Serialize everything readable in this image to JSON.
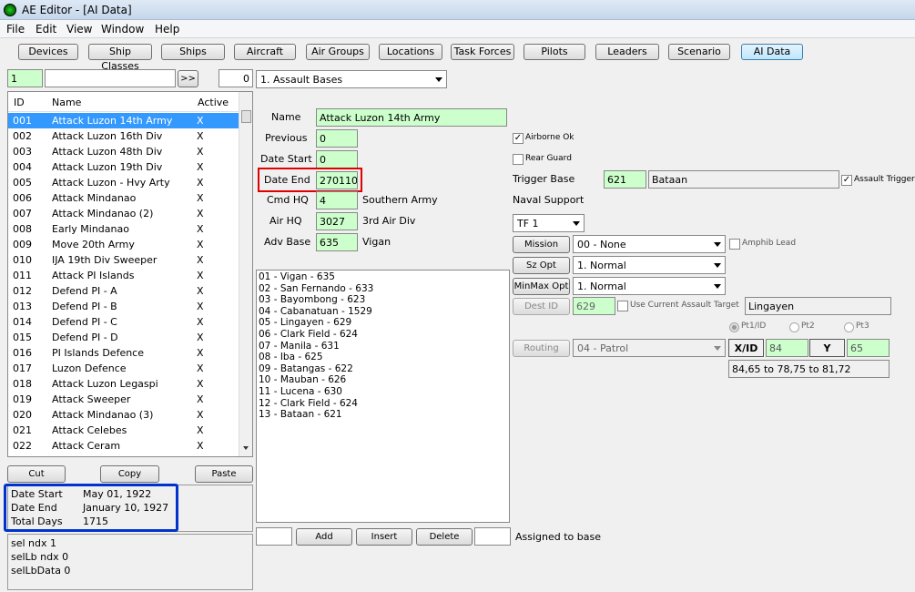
{
  "window": {
    "title": "AE Editor - [AI Data]"
  },
  "menu": [
    "File",
    "Edit",
    "View",
    "Window",
    "Help"
  ],
  "tabs": [
    "Devices",
    "Ship Classes",
    "Ships",
    "Aircraft",
    "Air Groups",
    "Locations",
    "Task Forces",
    "Pilots",
    "Leaders",
    "Scenario",
    "AI Data"
  ],
  "active_tab": "AI Data",
  "left": {
    "index_value": "1",
    "search_value": "",
    "go_label": ">>",
    "count_value": "0",
    "columns": [
      "ID",
      "Name",
      "Active"
    ],
    "rows": [
      {
        "id": "001",
        "name": "Attack Luzon 14th Army",
        "active": "X"
      },
      {
        "id": "002",
        "name": "Attack Luzon 16th Div",
        "active": "X"
      },
      {
        "id": "003",
        "name": "Attack Luzon 48th Div",
        "active": "X"
      },
      {
        "id": "004",
        "name": "Attack Luzon 19th Div",
        "active": "X"
      },
      {
        "id": "005",
        "name": "Attack Luzon - Hvy Arty",
        "active": "X"
      },
      {
        "id": "006",
        "name": "Attack Mindanao",
        "active": "X"
      },
      {
        "id": "007",
        "name": "Attack Mindanao (2)",
        "active": "X"
      },
      {
        "id": "008",
        "name": "Early Mindanao",
        "active": "X"
      },
      {
        "id": "009",
        "name": "Move 20th Army",
        "active": "X"
      },
      {
        "id": "010",
        "name": "IJA 19th Div Sweeper",
        "active": "X"
      },
      {
        "id": "011",
        "name": "Attack PI Islands",
        "active": "X"
      },
      {
        "id": "012",
        "name": "Defend PI - A",
        "active": "X"
      },
      {
        "id": "013",
        "name": "Defend PI - B",
        "active": "X"
      },
      {
        "id": "014",
        "name": "Defend PI - C",
        "active": "X"
      },
      {
        "id": "015",
        "name": "Defend PI - D",
        "active": "X"
      },
      {
        "id": "016",
        "name": "PI Islands Defence",
        "active": "X"
      },
      {
        "id": "017",
        "name": "Luzon Defence",
        "active": "X"
      },
      {
        "id": "018",
        "name": "Attack Luzon Legaspi",
        "active": "X"
      },
      {
        "id": "019",
        "name": "Attack Sweeper",
        "active": "X"
      },
      {
        "id": "020",
        "name": "Attack Mindanao (3)",
        "active": "X"
      },
      {
        "id": "021",
        "name": "Attack Celebes",
        "active": "X"
      },
      {
        "id": "022",
        "name": "Attack Ceram",
        "active": "X"
      }
    ],
    "cut_label": "Cut",
    "copy_label": "Copy",
    "paste_label": "Paste",
    "info": {
      "date_start_label": "Date Start",
      "date_start": "May 01, 1922",
      "date_end_label": "Date End",
      "date_end": "January 10, 1927",
      "total_days_label": "Total Days",
      "total_days": "1715"
    },
    "debug": [
      "sel ndx 1",
      "selLb ndx 0",
      "selLbData 0"
    ]
  },
  "mid": {
    "type_select": "1. Assault Bases",
    "name_label": "Name",
    "name_value": "Attack Luzon 14th Army",
    "previous_label": "Previous",
    "previous_value": "0",
    "date_start_label": "Date Start",
    "date_start_value": "0",
    "date_end_label": "Date End",
    "date_end_value": "270110",
    "cmd_hq_label": "Cmd HQ",
    "cmd_hq_value": "4",
    "cmd_hq_name": "Southern Army",
    "air_hq_label": "Air HQ",
    "air_hq_value": "3027",
    "air_hq_name": "3rd Air Div",
    "adv_base_label": "Adv Base",
    "adv_base_value": "635",
    "adv_base_name": "Vigan",
    "bases": [
      "01 - Vigan - 635",
      "02 - San Fernando - 633",
      "03 - Bayombong - 623",
      "04 - Cabanatuan - 1529",
      "05 - Lingayen - 629",
      "06 - Clark Field - 624",
      "07 - Manila - 631",
      "08 - Iba - 625",
      "09 - Batangas - 622",
      "10 - Mauban - 626",
      "11 - Lucena - 630",
      "12 - Clark Field - 624",
      "13 - Bataan - 621"
    ],
    "add_label": "Add",
    "insert_label": "Insert",
    "delete_label": "Delete",
    "assigned_label": "Assigned to base"
  },
  "right": {
    "airborne_label": "Airborne Ok",
    "airborne_checked": true,
    "rear_guard_label": "Rear Guard",
    "rear_guard_checked": false,
    "trigger_base_label": "Trigger Base",
    "trigger_base_value": "621",
    "trigger_base_name": "Bataan",
    "assault_trigger_label": "Assault Trigger",
    "assault_trigger_checked": true,
    "naval_support_label": "Naval Support",
    "tf_select": "TF 1",
    "mission_label": "Mission",
    "mission_value": "00 - None",
    "amphib_label": "Amphib Lead",
    "sz_opt_label": "Sz Opt",
    "sz_opt_value": "1. Normal",
    "minmax_label": "MinMax Opt",
    "minmax_value": "1. Normal",
    "dest_id_label": "Dest ID",
    "dest_id_value": "629",
    "use_current_label": "Use Current Assault Target",
    "dest_name": "Lingayen",
    "pt1_label": "Pt1/ID",
    "pt2_label": "Pt2",
    "pt3_label": "Pt3",
    "routing_label": "Routing",
    "routing_value": "04 - Patrol",
    "xid_label": "X/ID",
    "x_value": "84",
    "y_label": "Y",
    "y_value": "65",
    "route_text": "84,65 to 78,75 to 81,72"
  },
  "colors": {
    "selection": "#3399ff",
    "field_green": "#ccffcc",
    "highlight_red": "#e00000",
    "highlight_blue": "#0033cc"
  }
}
